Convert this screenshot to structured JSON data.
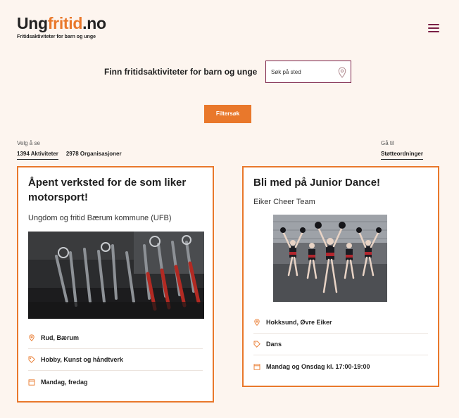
{
  "header": {
    "logo_part1": "Ung",
    "logo_part2": "fritid",
    "logo_part3": ".no",
    "tagline": "Fritidsaktiviteter for barn og unge",
    "menu_icon": "hamburger-icon"
  },
  "search": {
    "heading": "Finn fritidsaktiviteter for barn og unge",
    "placeholder": "Søk på sted",
    "location_icon": "map-pin-icon",
    "filter_label": "Filtersøk"
  },
  "view": {
    "velg_label": "Velg å se",
    "tabs": [
      {
        "label": "1394 Aktiviteter",
        "active": true
      },
      {
        "label": "2978 Organisasjoner",
        "active": false
      }
    ],
    "goto_label": "Gå til",
    "goto_link": "Støtteordninger"
  },
  "cards": [
    {
      "title": "Åpent verksted for de som liker motorsport!",
      "organizer": "Ungdom og fritid Bærum kommune (UFB)",
      "image": "tools-in-wrench-rack",
      "location": "Rud, Bærum",
      "category": "Hobby, Kunst og håndtverk",
      "schedule": "Mandag, fredag"
    },
    {
      "title": "Bli med på Junior Dance!",
      "organizer": "Eiker Cheer Team",
      "image": "cheer-dance-team",
      "location": "Hokksund, Øvre Eiker",
      "category": "Dans",
      "schedule": "Mandag og Onsdag kl. 17:00-19:00"
    }
  ],
  "colors": {
    "accent": "#e9782b",
    "brand_dark": "#7a1f45",
    "background": "#fdf5ef"
  }
}
